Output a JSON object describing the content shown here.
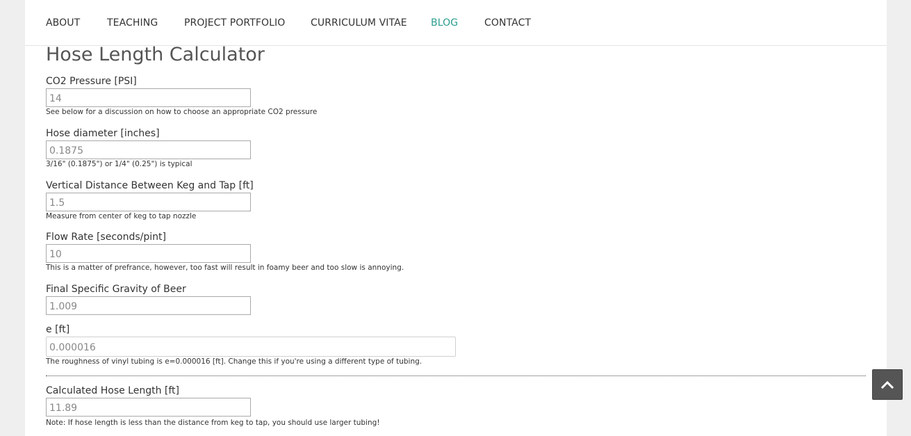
{
  "nav": {
    "items": [
      {
        "label": "ABOUT"
      },
      {
        "label": "TEACHING"
      },
      {
        "label": "PROJECT PORTFOLIO"
      },
      {
        "label": "CURRICULUM VITAE"
      },
      {
        "label": "BLOG",
        "active": true
      },
      {
        "label": "CONTACT"
      }
    ],
    "active_color": "#2a9d8f"
  },
  "calculator": {
    "title": "Hose Length Calculator",
    "fields": [
      {
        "label": "CO2 Pressure [PSI]",
        "value": "14",
        "help": "See below for a discussion on how to choose an appropriate CO2 pressure"
      },
      {
        "label": "Hose diameter [inches]",
        "value": "0.1875",
        "help": "3/16\" (0.1875\") or 1/4\" (0.25\") is typical"
      },
      {
        "label": "Vertical Distance Between Keg and Tap [ft]",
        "value": "1.5",
        "help": "Measure from center of keg to tap nozzle"
      },
      {
        "label": "Flow Rate [seconds/pint]",
        "value": "10",
        "help": "This is a matter of prefrance, however, too fast will result in foamy beer and too slow is annoying."
      },
      {
        "label": "Final Specific Gravity of Beer",
        "value": "1.009",
        "help": ""
      },
      {
        "label": "e [ft]",
        "value": "0.000016",
        "help": "The roughness of vinyl tubing is e=0.000016 [ft]. Change this if you're using a different type of tubing."
      }
    ],
    "result": {
      "label": "Calculated Hose Length [ft]",
      "value": "11.89",
      "note": "Note: If hose length is less than the distance from keg to tap, you should use larger tubing!"
    }
  },
  "scroll_top": {
    "icon": "chevron-up-icon"
  }
}
